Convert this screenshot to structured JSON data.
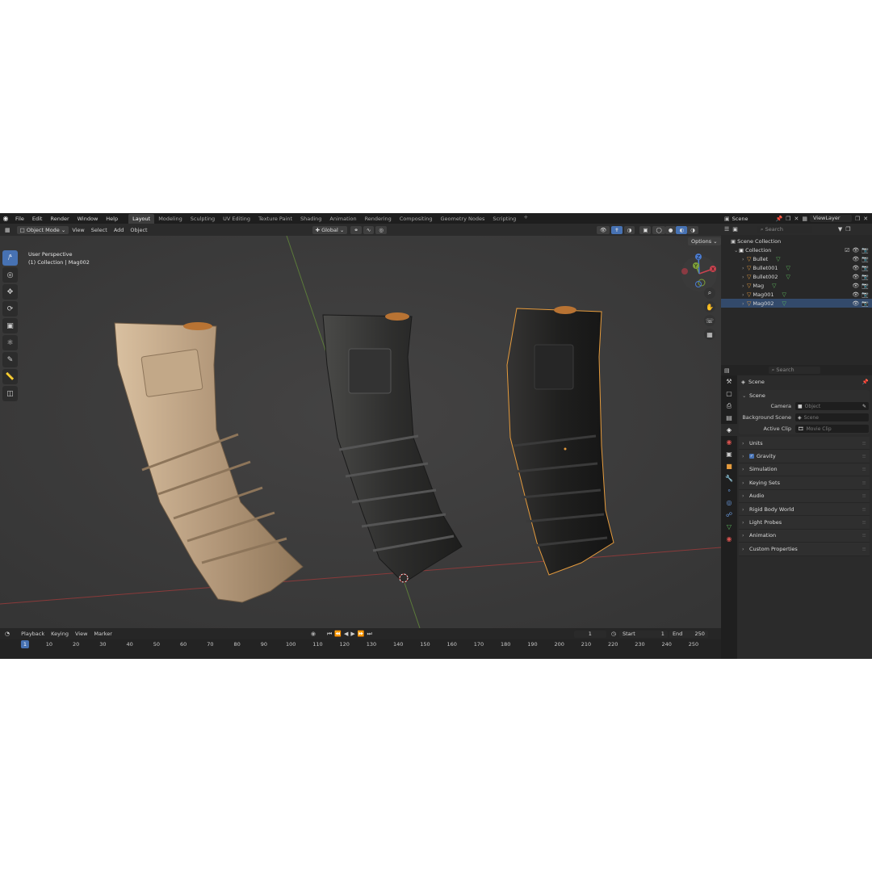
{
  "menu": {
    "items": [
      "File",
      "Edit",
      "Render",
      "Window",
      "Help"
    ],
    "workspaces": [
      "Layout",
      "Modeling",
      "Sculpting",
      "UV Editing",
      "Texture Paint",
      "Shading",
      "Animation",
      "Rendering",
      "Compositing",
      "Geometry Nodes",
      "Scripting"
    ],
    "active_workspace": "Layout",
    "add_tab": "+"
  },
  "scene_selector": {
    "scene": "Scene",
    "view_layer": "ViewLayer"
  },
  "viewport": {
    "mode": "Object Mode",
    "menus": [
      "View",
      "Select",
      "Add",
      "Object"
    ],
    "transform_orientation": "Global",
    "options_label": "Options",
    "perspective_label": "User Perspective",
    "active_info": "(1) Collection | Mag002",
    "gizmo_axes": [
      "X",
      "Y",
      "Z"
    ]
  },
  "outliner": {
    "search_placeholder": "Search",
    "root": "Scene Collection",
    "collection": "Collection",
    "objects": [
      "Bullet",
      "Bullet001",
      "Bullet002",
      "Mag",
      "Mag001",
      "Mag002"
    ]
  },
  "properties": {
    "search_placeholder": "Search",
    "context": "Scene",
    "panel_title": "Scene",
    "fields": [
      {
        "label": "Camera",
        "placeholder": "Object"
      },
      {
        "label": "Background Scene",
        "placeholder": "Scene"
      },
      {
        "label": "Active Clip",
        "placeholder": "Movie Clip"
      }
    ],
    "subpanels": [
      "Units",
      "Gravity",
      "Simulation",
      "Keying Sets",
      "Audio",
      "Rigid Body World",
      "Light Probes",
      "Animation",
      "Custom Properties"
    ],
    "gravity_checked": true
  },
  "timeline": {
    "menus": [
      "Playback",
      "Keying",
      "View",
      "Marker"
    ],
    "current_frame": "1",
    "start_label": "Start",
    "start_value": "1",
    "end_label": "End",
    "end_value": "250",
    "ticks": [
      "1",
      "10",
      "20",
      "30",
      "40",
      "50",
      "60",
      "70",
      "80",
      "90",
      "100",
      "110",
      "120",
      "130",
      "140",
      "150",
      "160",
      "170",
      "180",
      "190",
      "200",
      "210",
      "220",
      "230",
      "240",
      "250"
    ]
  },
  "colors": {
    "accent": "#4772b3",
    "object_orange": "#e59b3d",
    "mesh_green": "#5db85d",
    "mag_tan": "#b59a7c",
    "mag_dark": "#2e2e2d"
  }
}
